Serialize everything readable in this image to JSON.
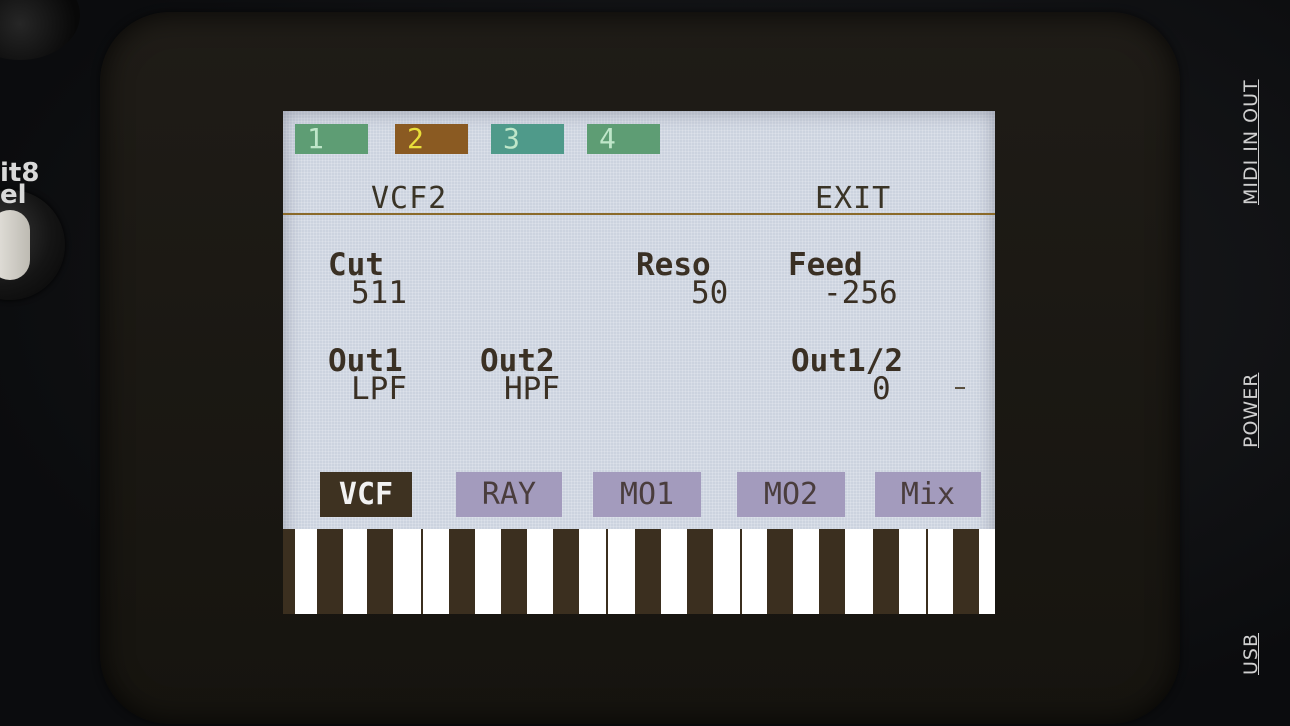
{
  "device": {
    "brand_label": "it8\nel",
    "ports": [
      "MIDI IN OUT",
      "POWER",
      "USB"
    ]
  },
  "tabs": [
    {
      "label": "1",
      "state": "normal"
    },
    {
      "label": "2",
      "state": "active"
    },
    {
      "label": "3",
      "state": "normal"
    },
    {
      "label": "4",
      "state": "normal"
    }
  ],
  "header": {
    "title": "VCF2",
    "exit_label": "EXIT"
  },
  "params": {
    "cut": {
      "label": "Cut",
      "value": "511"
    },
    "reso": {
      "label": "Reso",
      "value": "50"
    },
    "feed": {
      "label": "Feed",
      "value": "-256"
    },
    "out1": {
      "label": "Out1",
      "value": "LPF"
    },
    "out2": {
      "label": "Out2",
      "value": "HPF"
    },
    "out12": {
      "label": "Out1/2",
      "value": "0"
    }
  },
  "pages": [
    {
      "label": "VCF",
      "selected": true
    },
    {
      "label": "RAY",
      "selected": false
    },
    {
      "label": "MO1",
      "selected": false
    },
    {
      "label": "MO2",
      "selected": false
    },
    {
      "label": "Mix",
      "selected": false
    }
  ],
  "colors": {
    "lcd_bg": "#ccd3df",
    "tab_active": "#8a5a22",
    "tab_inactive": "#5e9d74",
    "page_selected": "#3e3221",
    "page_normal": "#a39bbd"
  }
}
